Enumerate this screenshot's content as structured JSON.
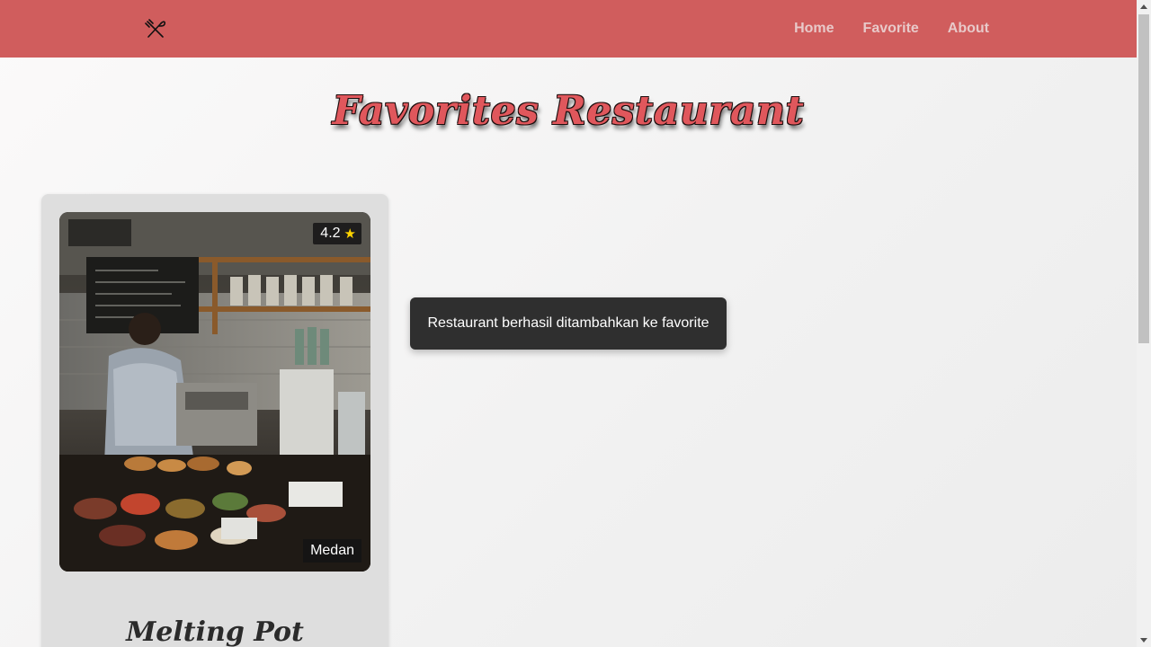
{
  "nav": {
    "logo_icon": "fork-knife-icon",
    "links": [
      "Home",
      "Favorite",
      "About"
    ]
  },
  "page": {
    "title": "Favorites Restaurant"
  },
  "restaurants": [
    {
      "name": "Melting Pot",
      "city": "Medan",
      "rating": "4.2",
      "rating_icon": "star-icon",
      "image": "cafe-kitchen-photo"
    }
  ],
  "toast": {
    "message": "Restaurant berhasil ditambahkan ke favorite"
  },
  "colors": {
    "navbar": "#d05d5d",
    "nav_link": "#e8c9c9",
    "title_fill": "#e0575c",
    "card_bg": "#dedede",
    "toast_bg": "#2f2f2f",
    "star": "#ffd400"
  }
}
